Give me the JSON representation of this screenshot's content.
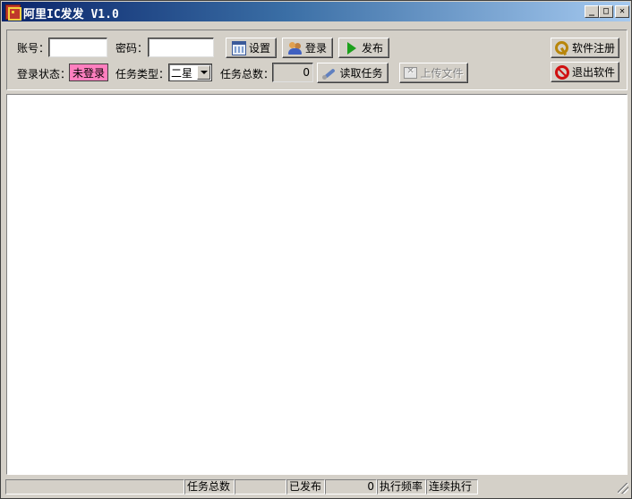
{
  "window": {
    "title": "阿里IC发发 V1.0",
    "caption_buttons": {
      "minimize": "_",
      "maximize": "□",
      "close": "✕"
    }
  },
  "toolbar": {
    "account_label": "账号：",
    "account_value": "",
    "password_label": "密码：",
    "password_value": "",
    "settings_label": "设置",
    "login_label": "登录",
    "publish_label": "发布",
    "register_label": "软件注册",
    "exit_label": "退出软件",
    "login_status_label": "登录状态：",
    "login_status_value": "未登录",
    "login_status_color": "#ff7fbf",
    "task_type_label": "任务类型：",
    "task_type_value": "二星",
    "task_total_label": "任务总数：",
    "task_total_value": "0",
    "read_tasks_label": "读取任务",
    "upload_file_label": "上传文件",
    "icons": {
      "settings": "calendar-grid-icon",
      "login": "users-icon",
      "publish": "play-icon",
      "register": "key-icon",
      "exit": "no-entry-icon",
      "read_tasks": "tools-icon",
      "upload_file": "upload-file-icon"
    }
  },
  "statusbar": {
    "task_total_label": "任务总数",
    "task_total_value": "",
    "published_label": "已发布",
    "published_value": "0",
    "frequency_label": "执行频率",
    "mode_value": "连续执行"
  }
}
